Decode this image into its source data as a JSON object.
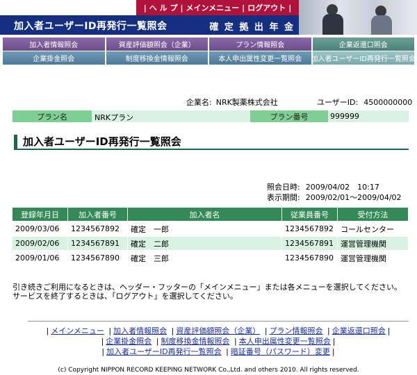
{
  "header": {
    "top_links": [
      "ヘ ル プ",
      "メインメニュー",
      "ログアウト"
    ],
    "title": "加入者ユーザーID再発行一覧照会",
    "system_name": "確 定 拠 出 年 金"
  },
  "menu": {
    "row1": [
      "加入者情報照会",
      "資産評価額照会（企業）",
      "プラン情報照会",
      "企業返還口照会"
    ],
    "row2": [
      "企業掛金照会",
      "制度移換金情報照会",
      "本人申出属性変更一覧照会",
      "加入者ユーザーID再発行一覧照会"
    ]
  },
  "company": {
    "label": "企業名:",
    "value": "NRK製薬株式会社",
    "userid_label": "ユーザーID:",
    "userid_value": "4500000000"
  },
  "plan": {
    "name_label": "プラン名",
    "name_value": "NRKプラン",
    "number_label": "プラン番号",
    "number_value": "999999"
  },
  "section_title": "加入者ユーザーID再発行一覧照会",
  "dates": {
    "ref_label": "照会日時:",
    "ref_value": "2009/04/02　10:17",
    "period_label": "表示期間:",
    "period_value": "2009/02/01～2009/04/02"
  },
  "table": {
    "headers": [
      "登録年月日",
      "加入者番号",
      "加入者名",
      "従業員番号",
      "受付方法"
    ],
    "rows": [
      [
        "2009/03/06",
        "1234567892",
        "確定　一郎",
        "1234567892",
        "コールセンター"
      ],
      [
        "2009/02/06",
        "1234567891",
        "確定　二郎",
        "1234567891",
        "運営管理機関"
      ],
      [
        "2009/01/06",
        "1234567890",
        "確定　三郎",
        "1234567890",
        "運営管理機関"
      ]
    ]
  },
  "notes": [
    "引き続きご利用になるときは、ヘッダー・フッターの「メインメニュー」または各メニューを選択してください。",
    "サービスを終了するときは、「ログアウト」を選択してください。"
  ],
  "footer": {
    "line1": [
      "メインメニュー",
      "加入者情報照会",
      "資産評価額照会（企業）",
      "プラン情報照会",
      "企業返還口照会"
    ],
    "line2": [
      "企業掛金照会",
      "制度移換金情報照会",
      "本人申出属性変更一覧照会"
    ],
    "line3": [
      "加入者ユーザーID再発行一覧照会",
      "暗証番号（パスワード）変更"
    ],
    "copyright": "(c) Copyright NIPPON RECORD KEEPING NETWORK Co.,Ltd. and others 2010. All rights reserved."
  }
}
